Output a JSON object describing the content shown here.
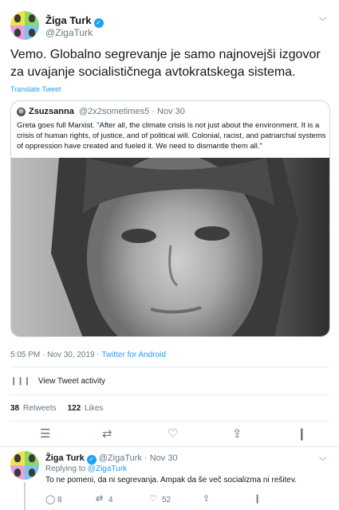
{
  "main_tweet": {
    "display_name": "Žiga Turk",
    "handle": "@ZigaTurk",
    "text": "Vemo. Globalno segrevanje je samo najnovejši izgovor za uvajanje socialističnega avtokratskega sistema.",
    "translate_label": "Translate Tweet",
    "quoted": {
      "display_name": "Zsuzsanna",
      "handle": "@2x2sometimes5",
      "date": "Nov 30",
      "text": "Greta goes full Marxist. \"After all, the climate crisis is not just about the environment. It is a crisis of human rights, of justice, and of political will. Colonial, racist, and patriarchal systems of oppression have created and fueled it. We need to dismantle them all.\""
    },
    "timestamp": "5:05 PM · Nov 30, 2019",
    "source": "Twitter for Android",
    "activity_label": "View Tweet activity",
    "retweets_count": "38",
    "retweets_label": "Retweets",
    "likes_count": "122",
    "likes_label": "Likes"
  },
  "reply": {
    "display_name": "Žiga Turk",
    "handle": "@ZigaTurk",
    "date": "Nov 30",
    "replying_to_label": "Replying to",
    "replying_to_handle": "@ZigaTurk",
    "text": "To ne pomeni, da ni segrevanja. Ampak da še več socializma ni rešitev.",
    "reply_count": "8",
    "retweet_count": "4",
    "like_count": "52"
  },
  "separator": "·",
  "colors": {
    "link_blue": "#1da1f2",
    "muted": "#657786",
    "border": "#e6ecf0"
  },
  "icons": [
    "verified-badge-icon",
    "chevron-down-icon",
    "bar-chart-icon",
    "reply-icon",
    "retweet-icon",
    "heart-icon",
    "share-icon"
  ]
}
